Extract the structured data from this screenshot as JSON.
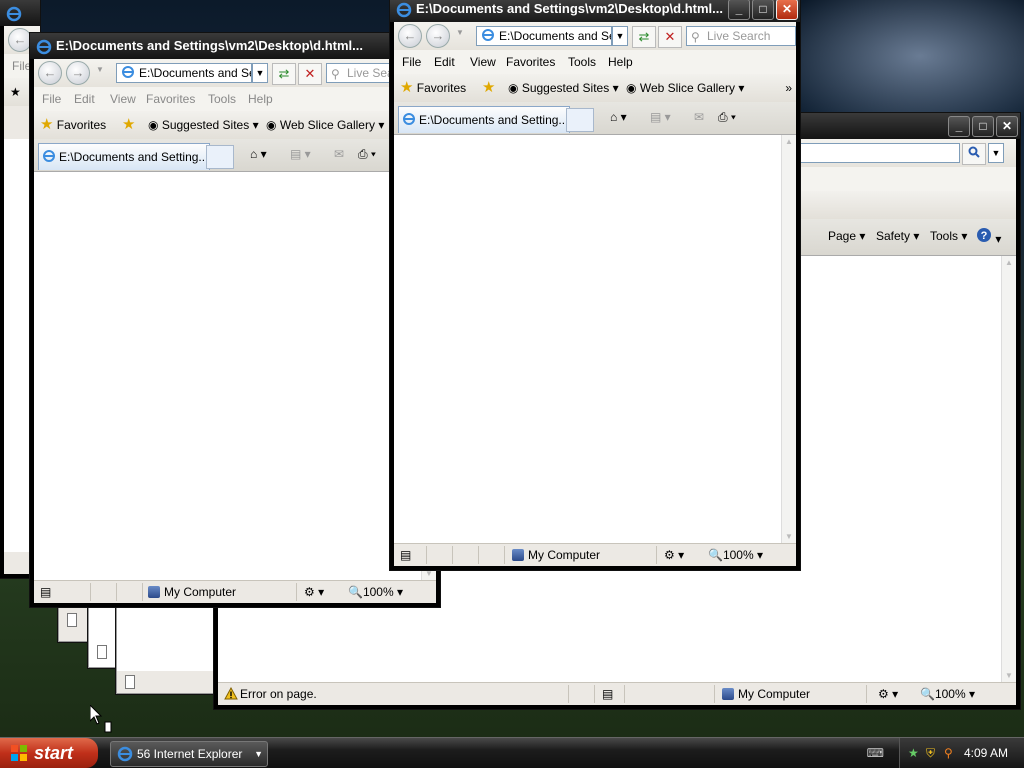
{
  "windows": [
    {
      "title": "E:\\Documents and Settings\\vm2\\Desktop\\d.html...",
      "address": "E:\\Documents and Set",
      "search_placeholder": "Live Sea",
      "menu": [
        "File",
        "Edit",
        "View",
        "Favorites",
        "Tools",
        "Help"
      ],
      "favorites_label": "Favorites",
      "suggested_sites": "Suggested Sites",
      "web_slice": "Web Slice Gallery",
      "tab_title": "E:\\Documents and Setting...",
      "status_zone": "My Computer",
      "zoom": "100%"
    },
    {
      "title": "E:\\Documents and Settings\\vm2\\Desktop\\d.html...",
      "address": "E:\\Documents and Set",
      "search_placeholder": "Live Search",
      "menu": [
        "File",
        "Edit",
        "View",
        "Favorites",
        "Tools",
        "Help"
      ],
      "favorites_label": "Favorites",
      "suggested_sites": "Suggested Sites",
      "web_slice": "Web Slice Gallery",
      "tab_title": "E:\\Documents and Setting...",
      "status_zone": "My Computer",
      "zoom": "100%"
    }
  ],
  "back_window": {
    "command_bar": [
      "Page",
      "Safety",
      "Tools"
    ],
    "status_text": "Error on page.",
    "status_zone": "My Computer",
    "zoom": "100%"
  },
  "background_windows": {
    "menu_first": "File"
  },
  "taskbar": {
    "start_label": "start",
    "item_label": "56 Internet Explorer",
    "clock": "4:09 AM"
  },
  "colors": {
    "titlebar": "#1c1c1c",
    "close_button": "#c8401e",
    "start_button": "#c0301a"
  }
}
